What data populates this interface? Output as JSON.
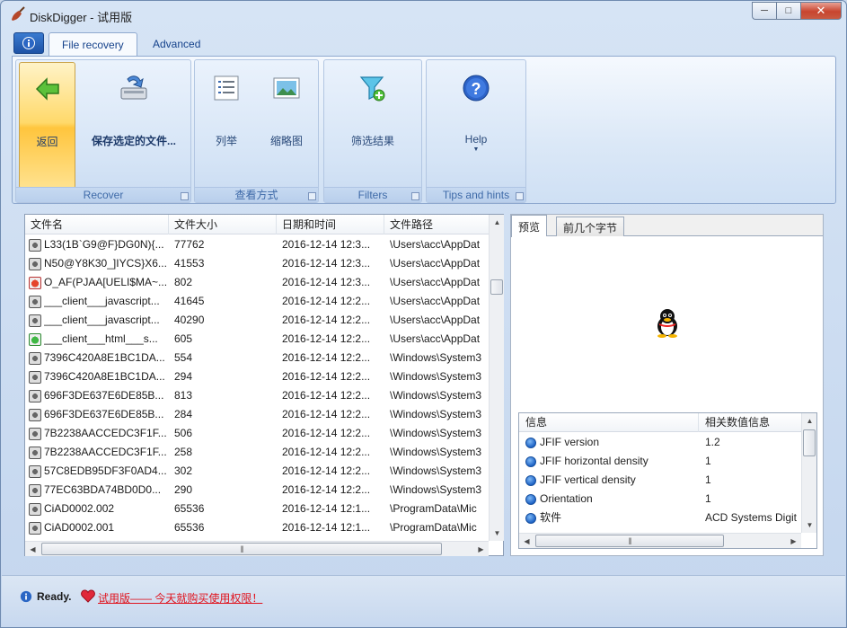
{
  "window": {
    "title": "DiskDigger - 试用版",
    "icon": "diskdigger-shovel-icon",
    "controls": {
      "minimize": "─",
      "maximize": "□",
      "close": "✕"
    }
  },
  "ribbon": {
    "app_menu_icon": "info-icon",
    "tabs": [
      {
        "label": "File recovery",
        "active": true
      },
      {
        "label": "Advanced",
        "active": false
      }
    ],
    "groups": {
      "recover": {
        "label": "Recover",
        "back_label": "返回",
        "save_label": "保存选定的文件..."
      },
      "view": {
        "label": "查看方式",
        "list_label": "列举",
        "thumbnail_label": "缩略图"
      },
      "filters": {
        "label": "Filters",
        "filter_label": "筛选结果"
      },
      "tips": {
        "label": "Tips and hints",
        "help_label": "Help"
      }
    }
  },
  "file_list": {
    "columns": [
      "文件名",
      "文件大小",
      "日期和时间",
      "文件路径"
    ],
    "rows": [
      {
        "icon": "gray",
        "name": "L33(1B`G9@F}DG0N){...",
        "size": "77762",
        "date": "2016-12-14 12:3...",
        "path": "\\Users\\acc\\AppDat"
      },
      {
        "icon": "gray",
        "name": "N50@Y8K30_]IYCS}X6...",
        "size": "41553",
        "date": "2016-12-14 12:3...",
        "path": "\\Users\\acc\\AppDat"
      },
      {
        "icon": "red",
        "name": "O_AF(PJAA[UELI$MA~...",
        "size": "802",
        "date": "2016-12-14 12:3...",
        "path": "\\Users\\acc\\AppDat"
      },
      {
        "icon": "gray",
        "name": "___client___javascript...",
        "size": "41645",
        "date": "2016-12-14 12:2...",
        "path": "\\Users\\acc\\AppDat"
      },
      {
        "icon": "gray",
        "name": "___client___javascript...",
        "size": "40290",
        "date": "2016-12-14 12:2...",
        "path": "\\Users\\acc\\AppDat"
      },
      {
        "icon": "green",
        "name": "___client___html___s...",
        "size": "605",
        "date": "2016-12-14 12:2...",
        "path": "\\Users\\acc\\AppDat"
      },
      {
        "icon": "gray",
        "name": "7396C420A8E1BC1DA...",
        "size": "554",
        "date": "2016-12-14 12:2...",
        "path": "\\Windows\\System3"
      },
      {
        "icon": "gray",
        "name": "7396C420A8E1BC1DA...",
        "size": "294",
        "date": "2016-12-14 12:2...",
        "path": "\\Windows\\System3"
      },
      {
        "icon": "gray",
        "name": "696F3DE637E6DE85B...",
        "size": "813",
        "date": "2016-12-14 12:2...",
        "path": "\\Windows\\System3"
      },
      {
        "icon": "gray",
        "name": "696F3DE637E6DE85B...",
        "size": "284",
        "date": "2016-12-14 12:2...",
        "path": "\\Windows\\System3"
      },
      {
        "icon": "gray",
        "name": "7B2238AACCEDC3F1F...",
        "size": "506",
        "date": "2016-12-14 12:2...",
        "path": "\\Windows\\System3"
      },
      {
        "icon": "gray",
        "name": "7B2238AACCEDC3F1F...",
        "size": "258",
        "date": "2016-12-14 12:2...",
        "path": "\\Windows\\System3"
      },
      {
        "icon": "gray",
        "name": "57C8EDB95DF3F0AD4...",
        "size": "302",
        "date": "2016-12-14 12:2...",
        "path": "\\Windows\\System3"
      },
      {
        "icon": "gray",
        "name": "77EC63BDA74BD0D0...",
        "size": "290",
        "date": "2016-12-14 12:2...",
        "path": "\\Windows\\System3"
      },
      {
        "icon": "gray",
        "name": "CiAD0002.002",
        "size": "65536",
        "date": "2016-12-14 12:1...",
        "path": "\\ProgramData\\Mic"
      },
      {
        "icon": "gray",
        "name": "CiAD0002.001",
        "size": "65536",
        "date": "2016-12-14 12:1...",
        "path": "\\ProgramData\\Mic"
      }
    ]
  },
  "preview": {
    "tabs": [
      {
        "label": "预览",
        "active": true
      },
      {
        "label": "前几个字节",
        "active": false
      }
    ],
    "image_icon": "qq-penguin-icon",
    "info_columns": [
      "信息",
      "相关数值信息"
    ],
    "info_rows": [
      {
        "key": "JFIF version",
        "value": "1.2"
      },
      {
        "key": "JFIF horizontal density",
        "value": "1"
      },
      {
        "key": "JFIF vertical density",
        "value": "1"
      },
      {
        "key": "Orientation",
        "value": "1"
      },
      {
        "key": "软件",
        "value": "ACD Systems Digit"
      }
    ]
  },
  "statusbar": {
    "status": "Ready.",
    "trial_text": "试用版—— 今天就购买使用权限！",
    "link_color": "#e0141e"
  }
}
